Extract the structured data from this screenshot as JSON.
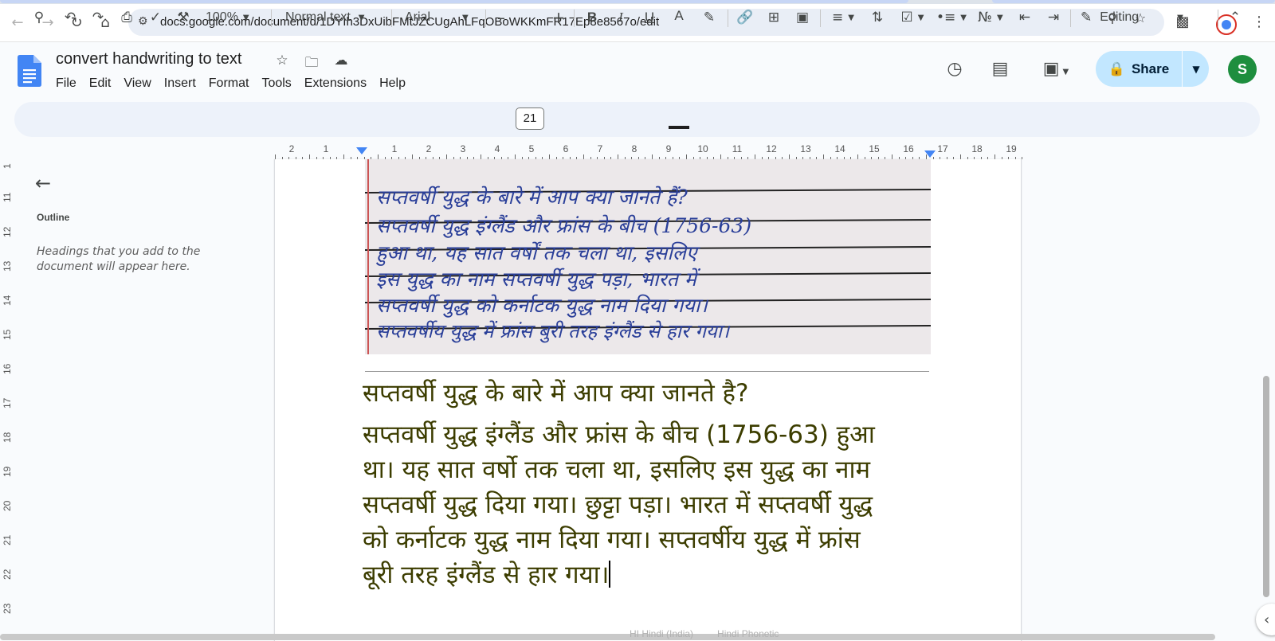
{
  "browser": {
    "url": "docs.google.com/document/d/1DYIh3DxUibFMtJZCUgAhLFqOBoWKKmFR17Ep8e8567o/edit",
    "icons": [
      "back-icon",
      "forward-icon",
      "reload-icon",
      "home-icon",
      "site-info-icon",
      "zoom-icon",
      "bookmark-star-icon",
      "extensions-icon",
      "profile-icon",
      "more-icon"
    ]
  },
  "doc": {
    "title": "convert handwriting to text",
    "menu": [
      "File",
      "Edit",
      "View",
      "Insert",
      "Format",
      "Tools",
      "Extensions",
      "Help"
    ],
    "share_label": "Share",
    "account_initial": "S"
  },
  "toolbar": {
    "zoom": "100%",
    "style": "Normal text",
    "font": "Arial",
    "font_size": "21",
    "mode": "Editing",
    "bold": "B",
    "italic": "I",
    "underline": "U",
    "text_color_letter": "A"
  },
  "ruler": {
    "labels": [
      "2",
      "1",
      "1",
      "2",
      "3",
      "4",
      "5",
      "6",
      "7",
      "8",
      "9",
      "10",
      "11",
      "12",
      "13",
      "14",
      "15",
      "16",
      "17",
      "18",
      "19"
    ],
    "vertical_labels": [
      "1",
      "11",
      "12",
      "13",
      "14",
      "15",
      "16",
      "17",
      "18",
      "19",
      "20",
      "21",
      "22",
      "23"
    ]
  },
  "outline": {
    "title": "Outline",
    "hint": "Headings that you add to the document will appear here."
  },
  "handwriting_image": {
    "lines": [
      "सप्तवर्षी युद्ध के बारे में आप क्या जानते हैं?",
      "सप्तवर्षी युद्ध इंग्लैंड और फ्रांस के बीच (1756-63)",
      "हुआ था, यह सात वर्षों तक चला था, इसलिए",
      "इस युद्ध का नाम सप्तवर्षी युद्ध पड़ा, भारत में",
      "सप्तवर्षी युद्ध को कर्नाटक युद्ध नाम दिया गया।",
      "सप्तवर्षीय युद्ध में फ्रांस बुरी तरह इंग्लैंड से हार गया।"
    ]
  },
  "content": {
    "heading": "सप्तवर्षी युद्ध के बारे में आप क्या जानते है?",
    "lines": [
      "सप्तवर्षी युद्ध इंग्लैंड और फ्रांस के बीच (1756-63) हुआ",
      "था। यह सात वर्षो तक चला था, इसलिए इस युद्ध का नाम",
      "सप्तवर्षी युद्ध दिया गया। छुट्टा पड़ा। भारत में सप्तवर्षी युद्ध",
      "को कर्नाटक युद्ध नाम दिया गया। सप्तवर्षीय युद्ध में फ्रांस",
      "बूरी तरह इंग्लैंड से हार गया।"
    ]
  },
  "status": {
    "ime_hindi": "HI Hindi (India)",
    "ime_phonetic": "Hindi Phonetic"
  }
}
